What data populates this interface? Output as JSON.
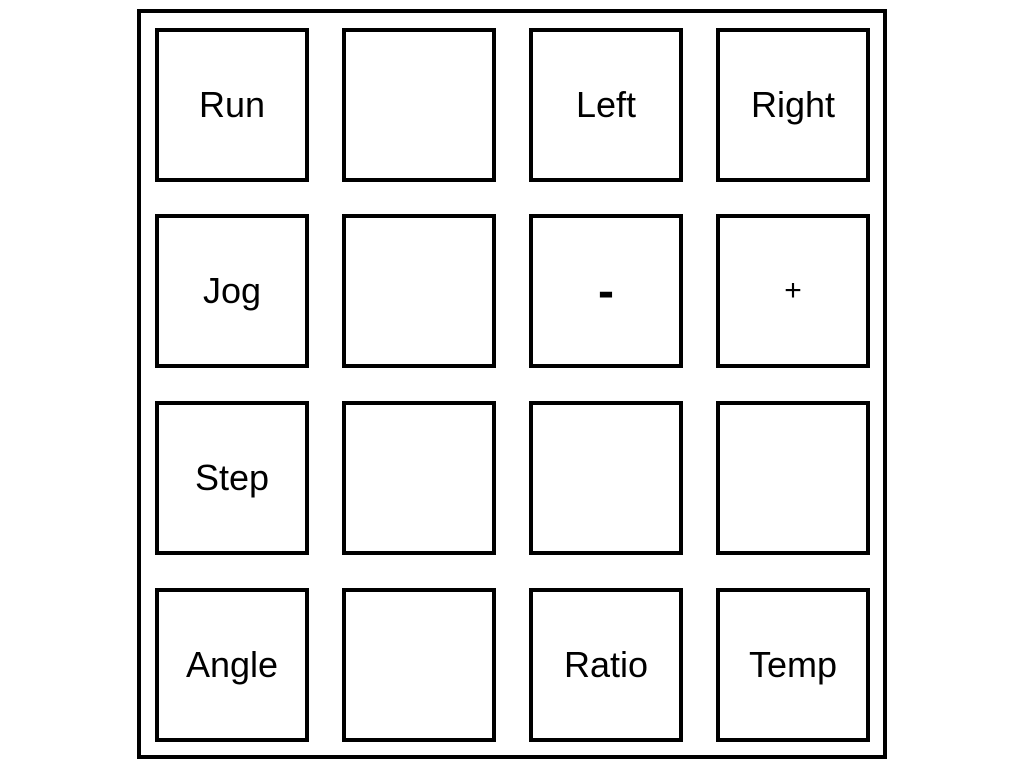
{
  "keypad": {
    "rows": [
      [
        {
          "label": "Run"
        },
        {
          "label": ""
        },
        {
          "label": "Left"
        },
        {
          "label": "Right"
        }
      ],
      [
        {
          "label": "Jog"
        },
        {
          "label": ""
        },
        {
          "label": "-"
        },
        {
          "label": "+"
        }
      ],
      [
        {
          "label": "Step"
        },
        {
          "label": ""
        },
        {
          "label": ""
        },
        {
          "label": ""
        }
      ],
      [
        {
          "label": "Angle"
        },
        {
          "label": ""
        },
        {
          "label": "Ratio"
        },
        {
          "label": "Temp"
        }
      ]
    ]
  }
}
